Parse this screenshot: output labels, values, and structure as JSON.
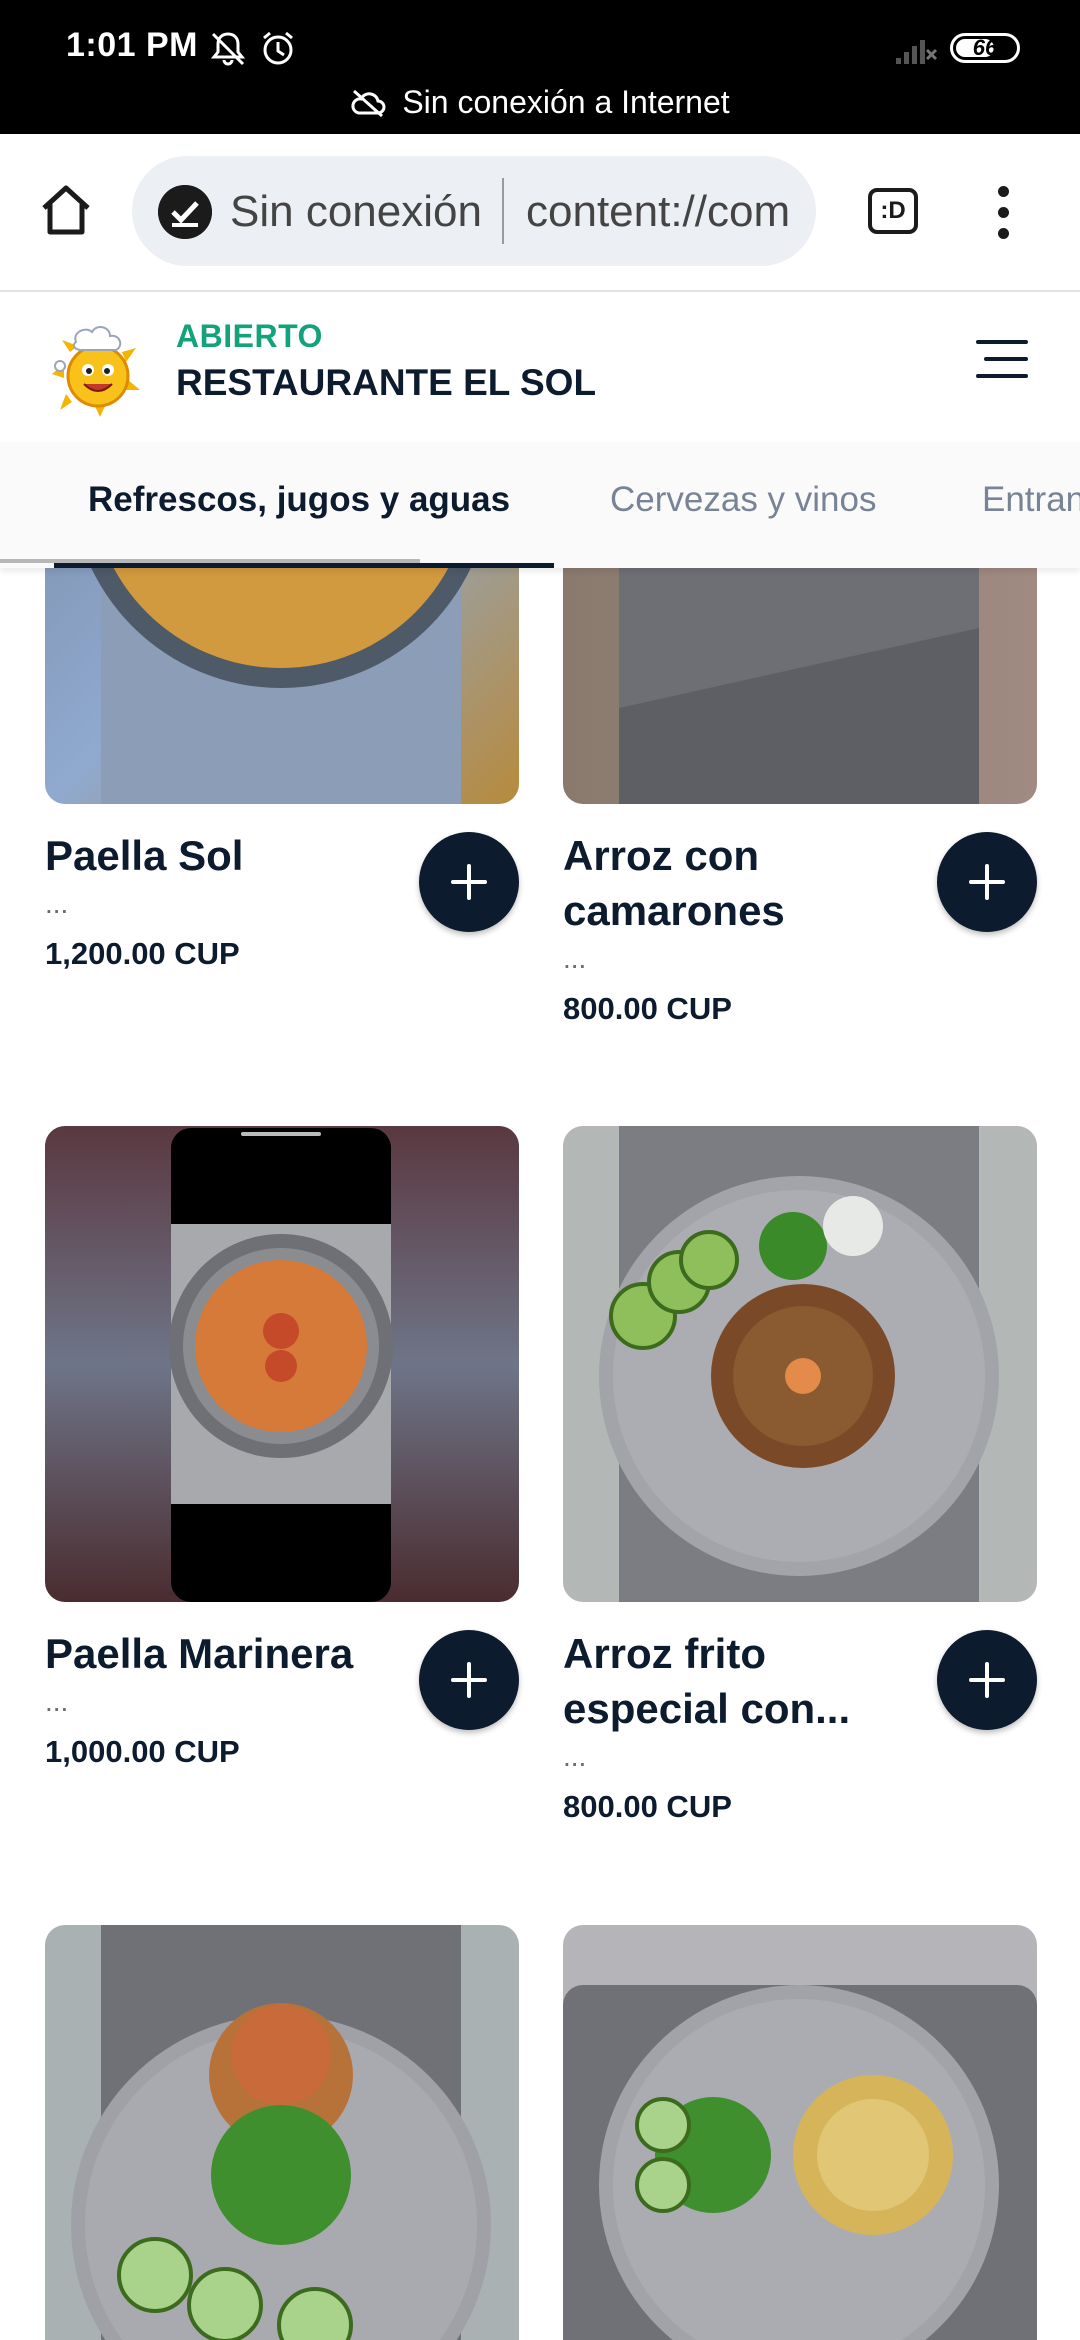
{
  "status_bar": {
    "time": "1:01 PM",
    "offline_notice": "Sin conexión a Internet",
    "battery": "66",
    "icons": [
      "bell-off-icon",
      "alarm-icon",
      "signal-off-icon",
      "battery-icon",
      "cloud-off-icon"
    ]
  },
  "browser": {
    "status_label": "Sin conexión",
    "url": "content://com",
    "tabs_label": ":D",
    "icons": [
      "home-icon",
      "offline-check-icon",
      "tab-switcher-icon",
      "more-vert-icon"
    ]
  },
  "restaurant": {
    "status": "ABIERTO",
    "name": "RESTAURANTE EL SOL",
    "status_color": "#12a37a",
    "brand_color": "#0d1b2e"
  },
  "categories": [
    {
      "label": "Refrescos, jugos y aguas",
      "active": true
    },
    {
      "label": "Cervezas y vinos",
      "active": false
    },
    {
      "label": "Entrantes",
      "active": false
    }
  ],
  "products": [
    {
      "name": "Paella Sol",
      "desc": "...",
      "price": "1,200.00 CUP"
    },
    {
      "name": "Arroz con camarones",
      "desc": "...",
      "price": "800.00 CUP"
    },
    {
      "name": "Paella Marinera",
      "desc": "...",
      "price": "1,000.00 CUP"
    },
    {
      "name": "Arroz frito especial con...",
      "desc": "...",
      "price": "800.00 CUP"
    },
    {
      "name": "",
      "desc": "",
      "price": ""
    },
    {
      "name": "",
      "desc": "",
      "price": ""
    }
  ]
}
